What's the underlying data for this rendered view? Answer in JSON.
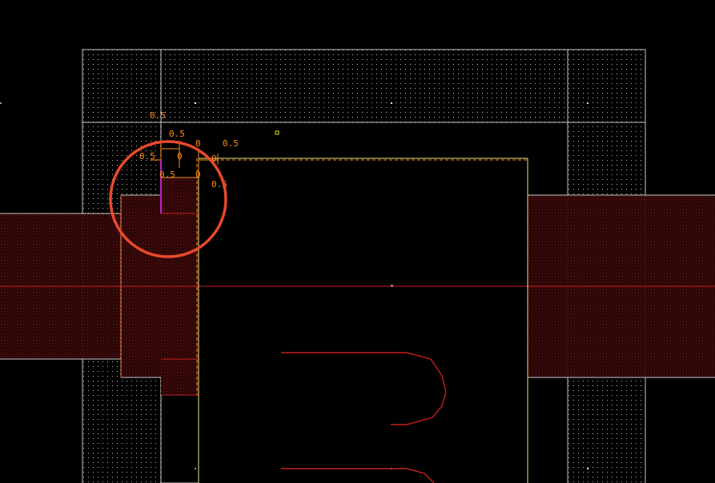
{
  "app": {
    "view": "layout-editor-canvas",
    "background_color": "#000000"
  },
  "colors": {
    "boundary_white": "#c8c8c8",
    "gate_yellow": "#e8e87a",
    "poly_red": "#c81e1e",
    "diff_fill": "#3a0808",
    "metal_magenta": "#c020c0",
    "dimension_orange": "#ff8c1a",
    "highlight_circle": "#e84a2a",
    "dot_white": "#d8d8d8",
    "marker_yellow": "#e8e800"
  },
  "dimensions": [
    {
      "id": "d1",
      "text": "0.5"
    },
    {
      "id": "d2",
      "text": "0.5"
    },
    {
      "id": "d3",
      "text": "0"
    },
    {
      "id": "d4",
      "text": "0.5"
    },
    {
      "id": "d5",
      "text": "0.5"
    },
    {
      "id": "d6",
      "text": "0"
    },
    {
      "id": "d7",
      "text": "0"
    },
    {
      "id": "d8",
      "text": "0.5"
    },
    {
      "id": "d9",
      "text": "0"
    },
    {
      "id": "d10",
      "text": "0.5"
    }
  ],
  "annotation": {
    "type": "highlight-circle",
    "color": "#e84a2a"
  }
}
